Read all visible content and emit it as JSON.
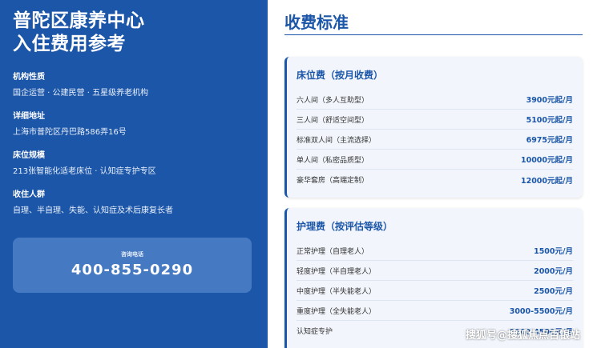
{
  "left": {
    "title_line1": "普陀区康养中心",
    "title_line2": "入住费用参考",
    "sections": [
      {
        "label": "机构性质",
        "value": "国企运营 · 公建民营 · 五星级养老机构"
      },
      {
        "label": "详细地址",
        "value": "上海市普陀区丹巴路586弄16号"
      },
      {
        "label": "床位规模",
        "value": "213张智能化适老床位 · 认知症专护专区"
      },
      {
        "label": "收住人群",
        "value": "自理、半自理、失能、认知症及术后康复长者"
      }
    ],
    "contact": {
      "label": "咨询电话",
      "phone": "400-855-0290"
    }
  },
  "right": {
    "heading": "收费标准",
    "cards": [
      {
        "title": "床位费（按月收费）",
        "rows": [
          {
            "name": "六人间（多人互助型）",
            "price": "3900元起/月"
          },
          {
            "name": "三人间（舒适空间型）",
            "price": "5100元起/月"
          },
          {
            "name": "标准双人间（主流选择）",
            "price": "6975元起/月"
          },
          {
            "name": "单人间（私密品质型）",
            "price": "10000元起/月"
          },
          {
            "name": "豪华套房（高端定制）",
            "price": "12000元起/月"
          }
        ]
      },
      {
        "title": "护理费（按评估等级）",
        "rows": [
          {
            "name": "正常护理（自理老人）",
            "price": "1500元/月"
          },
          {
            "name": "轻度护理（半自理老人）",
            "price": "2000元/月"
          },
          {
            "name": "中度护理（半失能老人）",
            "price": "2500元/月"
          },
          {
            "name": "重度护理（全失能老人）",
            "price": "3000-5500元/月"
          },
          {
            "name": "认知症专护",
            "price": "3000-4500元/月"
          }
        ]
      }
    ]
  },
  "watermark": "搜狐号@搜狐焦点百银站",
  "colors": {
    "primary": "#1c56a8",
    "card_bg": "#f2f6fc",
    "contact_bg": "#4579c2"
  }
}
